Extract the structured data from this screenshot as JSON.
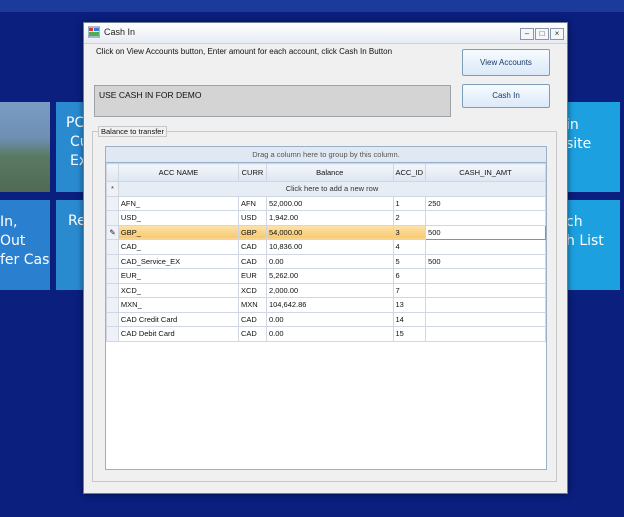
{
  "background": {
    "tiles": {
      "left1_text": [
        "PC",
        "Cu",
        "Ex"
      ],
      "left2_text": [
        "In,",
        "Out",
        "fer Cash"
      ],
      "left2b_text": [
        "Re"
      ],
      "right1_text": [
        "in",
        "site"
      ],
      "right2_text": [
        "ch",
        "h List"
      ]
    },
    "colors": {
      "desktop": "#0a1f7e",
      "tile_blue": "#2a8ad0",
      "tile_cyan": "#1ca0e0"
    }
  },
  "window": {
    "title": "Cash In",
    "controls": {
      "minimize": "–",
      "maximize": "□",
      "close": "×"
    },
    "instruction": "Click on View Accounts button, Enter amount for each account,  click Cash In Button",
    "demo_text": "USE CASH IN FOR DEMO",
    "buttons": {
      "view_accounts": "View Accounts",
      "cash_in": "Cash In"
    },
    "group_label": "Balance to transfer"
  },
  "grid": {
    "group_panel_text": "Drag a column here to group by this column.",
    "headers": [
      "ACC NAME",
      "CURR",
      "Balance",
      "ACC_ID",
      "CASH_IN_AMT"
    ],
    "add_row_text": "Click here to add a new row",
    "add_row_indicator": "*",
    "edit_indicator": "✎",
    "rows": [
      {
        "name": "AFN_",
        "curr": "AFN",
        "balance": "52,000.00",
        "id": "1",
        "amt": "250"
      },
      {
        "name": "USD_",
        "curr": "USD",
        "balance": "1,942.00",
        "id": "2",
        "amt": ""
      },
      {
        "name": "GBP_",
        "curr": "GBP",
        "balance": "54,000.00",
        "id": "3",
        "amt": "500"
      },
      {
        "name": "CAD_",
        "curr": "CAD",
        "balance": "10,836.00",
        "id": "4",
        "amt": ""
      },
      {
        "name": "CAD_Service_EX",
        "curr": "CAD",
        "balance": "0.00",
        "id": "5",
        "amt": "500"
      },
      {
        "name": "EUR_",
        "curr": "EUR",
        "balance": "5,262.00",
        "id": "6",
        "amt": ""
      },
      {
        "name": "XCD_",
        "curr": "XCD",
        "balance": "2,000.00",
        "id": "7",
        "amt": ""
      },
      {
        "name": "MXN_",
        "curr": "MXN",
        "balance": "104,642.86",
        "id": "13",
        "amt": ""
      },
      {
        "name": "CAD Credit Card",
        "curr": "CAD",
        "balance": "0.00",
        "id": "14",
        "amt": ""
      },
      {
        "name": "CAD Debit Card",
        "curr": "CAD",
        "balance": "0.00",
        "id": "15",
        "amt": ""
      }
    ]
  }
}
